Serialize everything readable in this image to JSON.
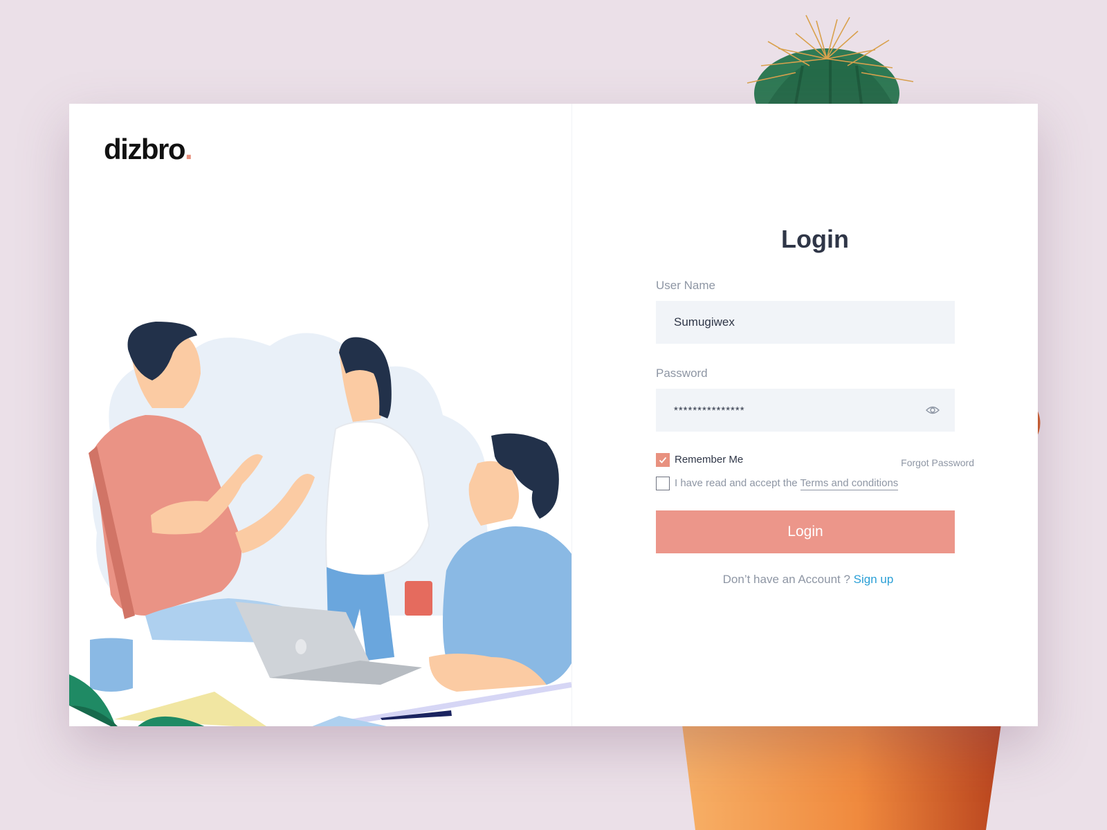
{
  "brand": {
    "name": "dizbro",
    "dot": ".",
    "accent": "#e8917f"
  },
  "login": {
    "title": "Login",
    "username_label": "User Name",
    "username_value": "Sumugiwex",
    "password_label": "Password",
    "password_value": "***************",
    "remember_label": "Remember Me",
    "remember_checked": true,
    "forgot_label": "Forgot Password",
    "terms_prefix": "I have read and accept the",
    "terms_link": "Terms and conditions",
    "terms_checked": false,
    "submit_label": "Login",
    "signup_prompt": "Don’t have an Account ?",
    "signup_link": "Sign up"
  },
  "colors": {
    "background": "#ebe0e8",
    "button": "#ec968a",
    "input_bg": "#f1f4f8",
    "link": "#2a9fd6",
    "heading": "#2f3647"
  },
  "icons": [
    "eye-icon",
    "checkmark-icon"
  ]
}
